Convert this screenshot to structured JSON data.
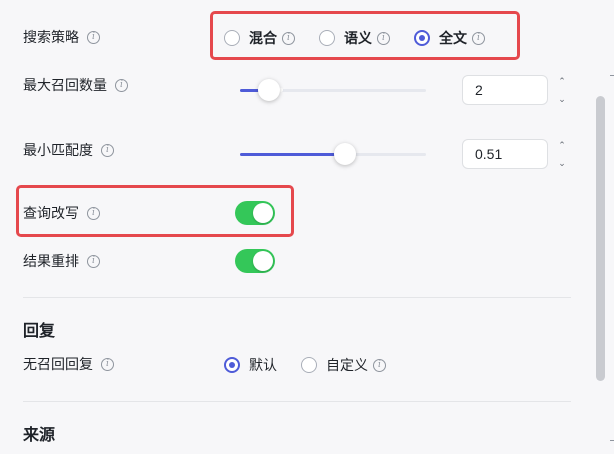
{
  "search_strategy": {
    "label": "搜索策略",
    "options": [
      {
        "label": "混合",
        "selected": false
      },
      {
        "label": "语义",
        "selected": false
      },
      {
        "label": "全文",
        "selected": true
      }
    ]
  },
  "max_recall": {
    "label": "最大召回数量",
    "value": "2",
    "slider_fraction": 0.1
  },
  "min_match": {
    "label": "最小匹配度",
    "value": "0.51",
    "slider_fraction": 0.51
  },
  "query_rewrite": {
    "label": "查询改写",
    "enabled": true
  },
  "result_rerank": {
    "label": "结果重排",
    "enabled": true
  },
  "reply": {
    "title": "回复",
    "no_recall_reply": {
      "label": "无召回回复",
      "options": [
        {
          "label": "默认",
          "selected": true
        },
        {
          "label": "自定义",
          "selected": false
        }
      ]
    }
  },
  "source": {
    "title": "来源"
  },
  "icons": {
    "info": "info-icon",
    "stepper_up": "chevron-up-icon",
    "stepper_down": "chevron-down-icon"
  },
  "colors": {
    "accent": "#4e5bd8",
    "toggle_on": "#34c759",
    "highlight_box": "#e5484d"
  }
}
